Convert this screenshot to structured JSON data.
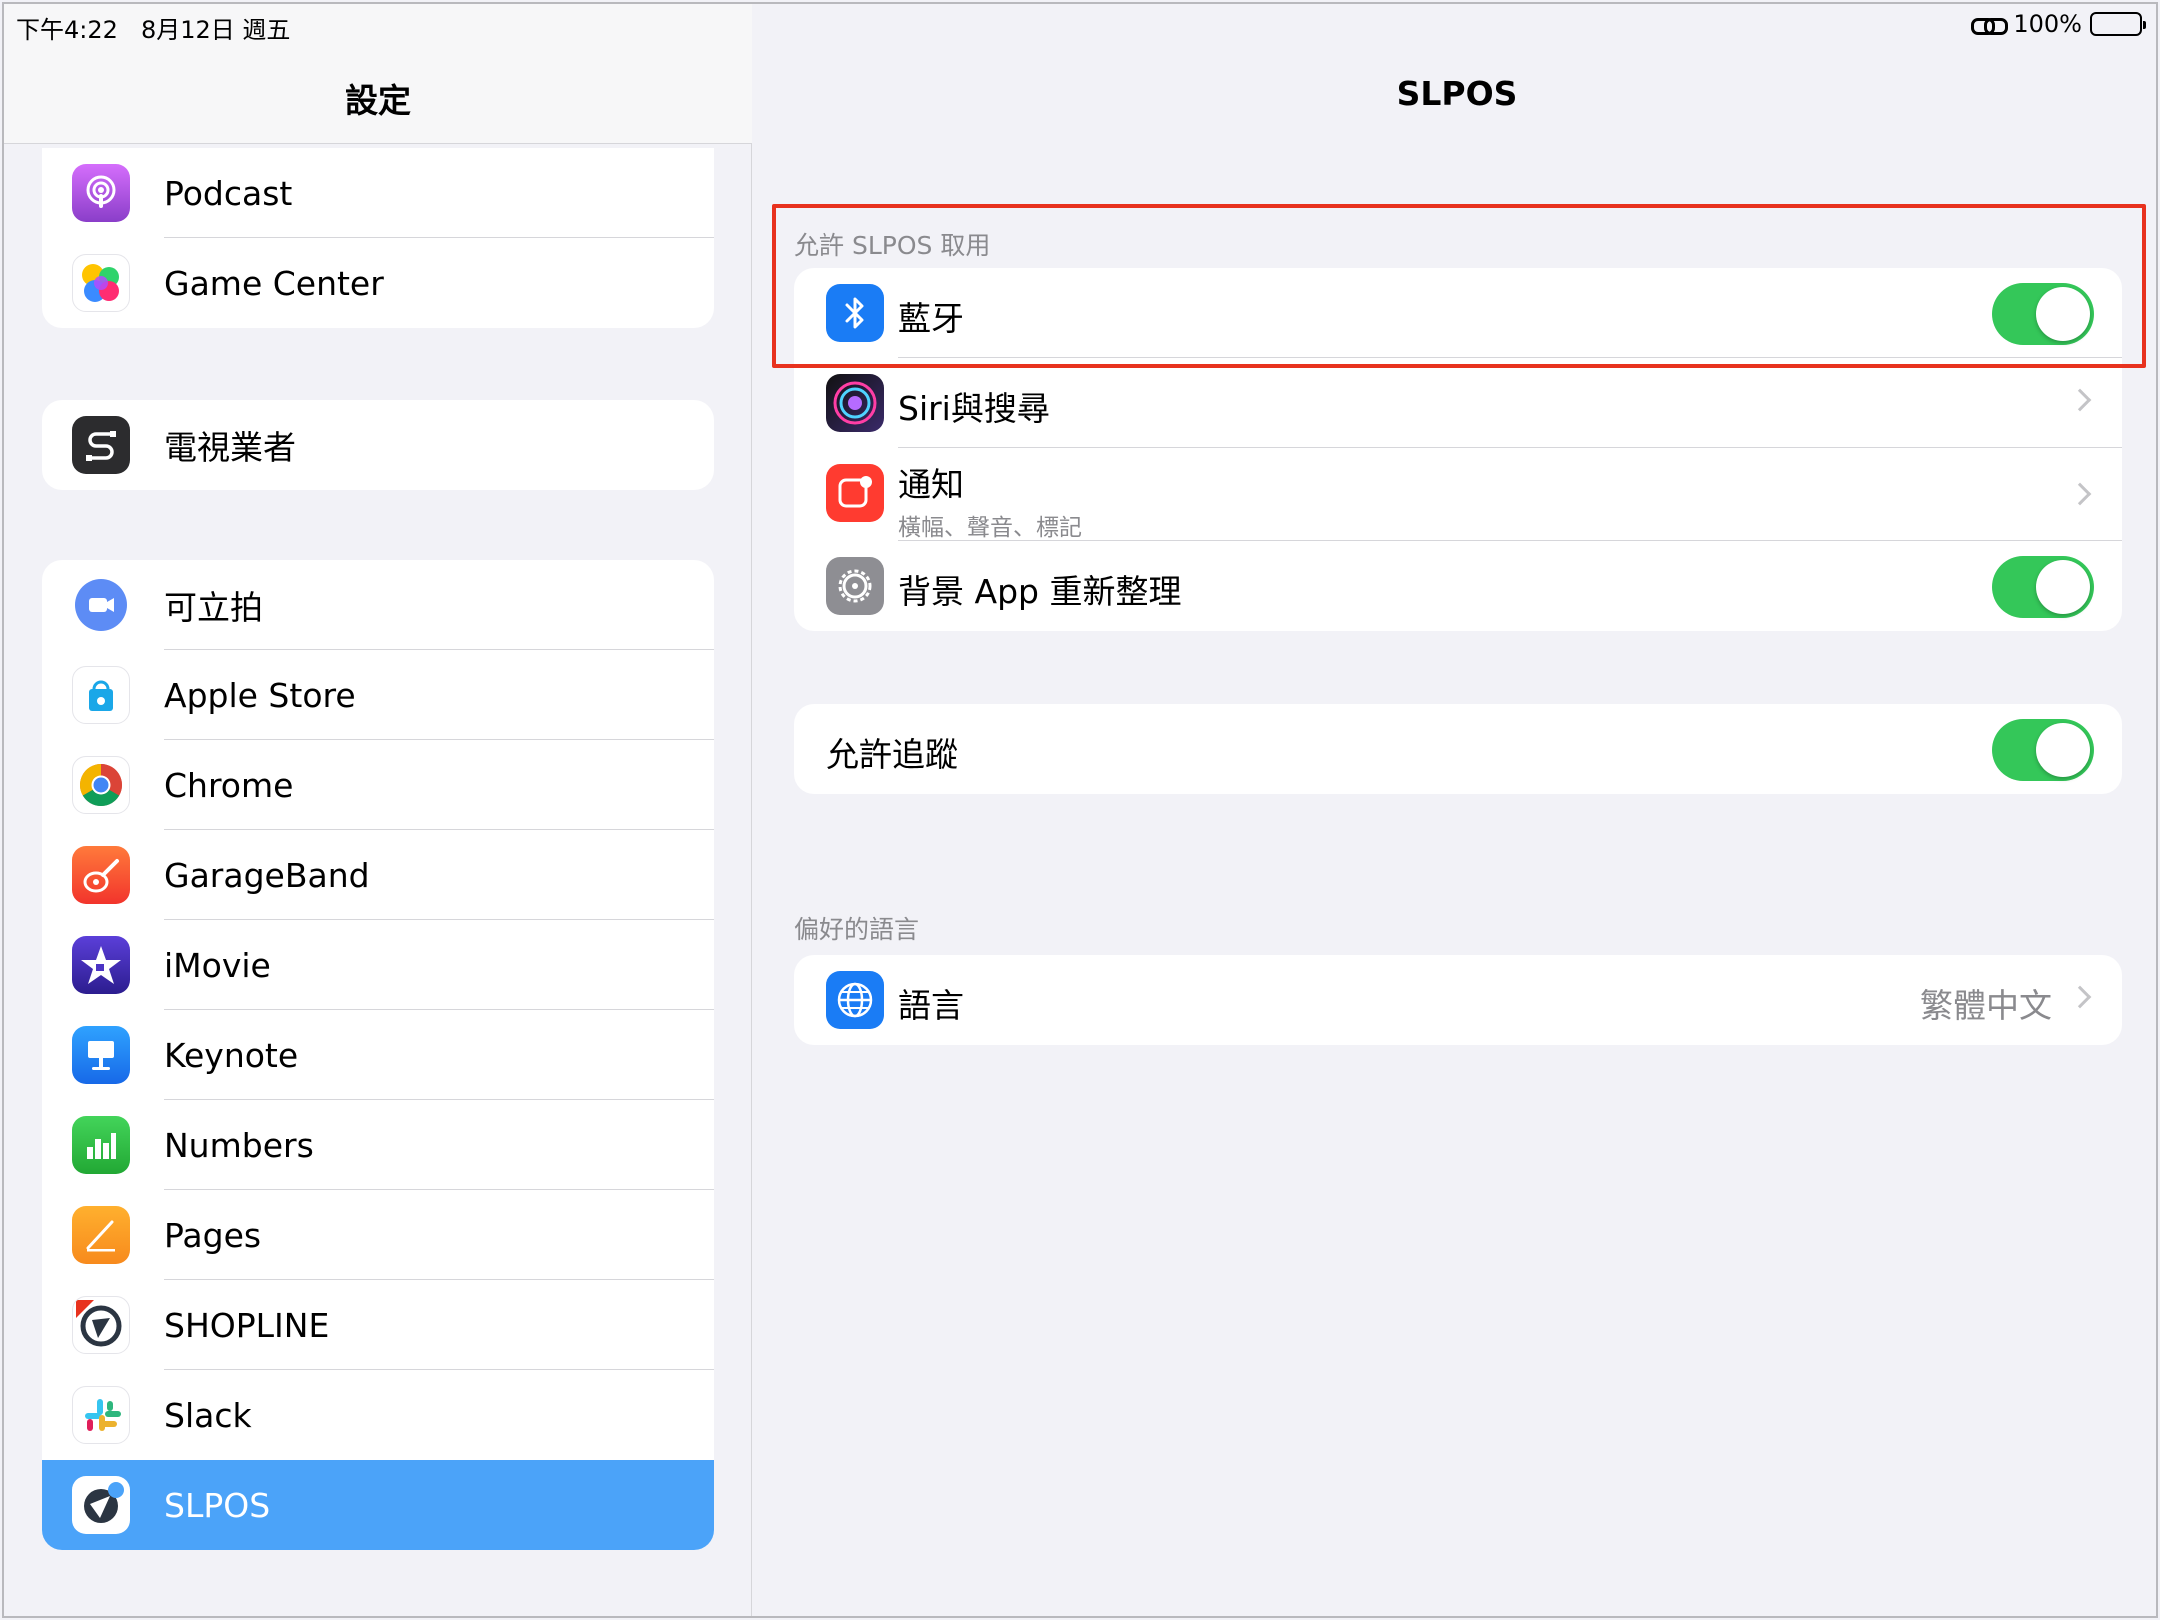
{
  "status": {
    "time": "下午4:22",
    "date": "8月12日 週五",
    "battery": "100%",
    "battery_level": 1.0
  },
  "sidebar": {
    "title": "設定",
    "group1": [
      {
        "label": "Podcast",
        "icon": "podcast-icon"
      },
      {
        "label": "Game Center",
        "icon": "game-center-icon"
      }
    ],
    "group2": [
      {
        "label": "電視業者",
        "icon": "tv-provider-icon"
      }
    ],
    "group3": [
      {
        "label": "可立拍",
        "icon": "clips-icon"
      },
      {
        "label": "Apple Store",
        "icon": "apple-store-icon"
      },
      {
        "label": "Chrome",
        "icon": "chrome-icon"
      },
      {
        "label": "GarageBand",
        "icon": "garageband-icon"
      },
      {
        "label": "iMovie",
        "icon": "imovie-icon"
      },
      {
        "label": "Keynote",
        "icon": "keynote-icon"
      },
      {
        "label": "Numbers",
        "icon": "numbers-icon"
      },
      {
        "label": "Pages",
        "icon": "pages-icon"
      },
      {
        "label": "SHOPLINE",
        "icon": "shopline-icon"
      },
      {
        "label": "Slack",
        "icon": "slack-icon"
      },
      {
        "label": "SLPOS",
        "icon": "slpos-icon",
        "selected": true
      }
    ]
  },
  "detail": {
    "title": "SLPOS",
    "access_section": "允許 SLPOS 取用",
    "access": [
      {
        "label": "藍牙",
        "icon": "bluetooth-icon",
        "control": "toggle",
        "on": true
      },
      {
        "label": "Siri與搜尋",
        "icon": "siri-icon",
        "control": "chevron"
      },
      {
        "label": "通知",
        "sub": "橫幅、聲音、標記",
        "icon": "notifications-icon",
        "control": "chevron"
      },
      {
        "label": "背景 App 重新整理",
        "icon": "gear-icon",
        "control": "toggle",
        "on": true
      }
    ],
    "tracking": {
      "label": "允許追蹤",
      "on": true
    },
    "language_section": "偏好的語言",
    "language": {
      "label": "語言",
      "value": "繁體中文",
      "icon": "globe-icon"
    }
  },
  "colors": {
    "accent_selected": "#4ba3f9",
    "toggle_on": "#34c759",
    "highlight_border": "#e8321e"
  }
}
